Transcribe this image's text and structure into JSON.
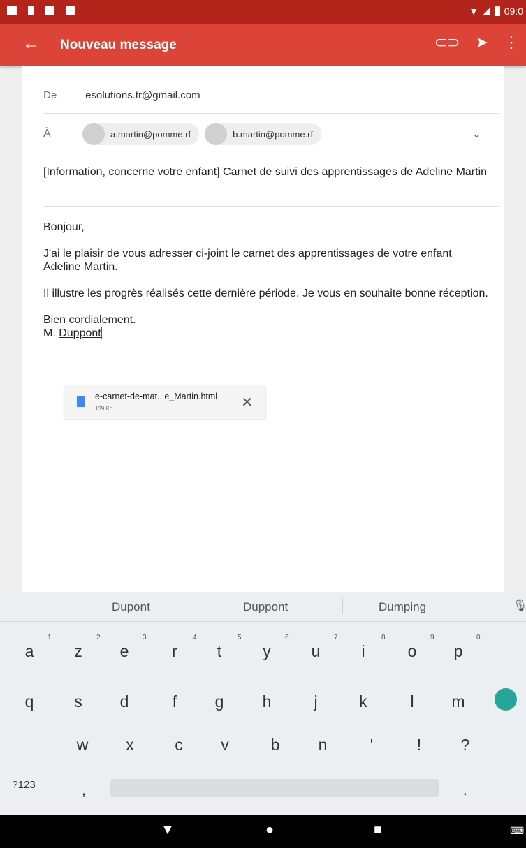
{
  "status_bar": {
    "time": "09:0"
  },
  "app_bar": {
    "title": "Nouveau message"
  },
  "compose": {
    "from_label": "De",
    "from_value": "esolutions.tr@gmail.com",
    "to_label": "À",
    "recipients": [
      "a.martin@pomme.rf",
      "b.martin@pomme.rf"
    ],
    "subject": "[Information, concerne votre enfant] Carnet de suivi des apprentissages de Adeline Martin",
    "body": {
      "greeting": "Bonjour,",
      "p1": "J'ai le plaisir de vous adresser ci-joint le carnet des apprentissages de votre enfant Adeline Martin.",
      "p2": "Il illustre les progrès réalisés cette dernière période. Je vous en souhaite bonne réception.",
      "closing": "Bien cordialement.",
      "signature_prefix": "M. ",
      "signature_name": "Duppont"
    },
    "attachment": {
      "name": "e-carnet-de-mat...e_Martin.html",
      "size": "139 Ko"
    }
  },
  "keyboard": {
    "suggestions": [
      "Dupont",
      "Duppont",
      "Dumping"
    ],
    "row1": [
      "a",
      "z",
      "e",
      "r",
      "t",
      "y",
      "u",
      "i",
      "o",
      "p"
    ],
    "row1_hints": [
      "1",
      "2",
      "3",
      "4",
      "5",
      "6",
      "7",
      "8",
      "9",
      "0"
    ],
    "row2": [
      "q",
      "s",
      "d",
      "f",
      "g",
      "h",
      "j",
      "k",
      "l",
      "m"
    ],
    "row3": [
      "w",
      "x",
      "c",
      "v",
      "b",
      "n",
      "'",
      "!",
      "?"
    ],
    "symbols_key": "?123",
    "comma_key": ",",
    "period_key": "."
  },
  "icons": [
    "back-arrow-icon",
    "attach-icon",
    "send-icon",
    "more-vert-icon",
    "chevron-down-icon",
    "file-icon",
    "close-icon",
    "mic-icon",
    "backspace-icon",
    "enter-icon",
    "shift-icon",
    "emoji-icon",
    "nav-back-icon",
    "nav-home-icon",
    "nav-recents-icon",
    "keyboard-icon"
  ],
  "colors": {
    "app_bar": "#db4437",
    "status_bar": "#b3251b",
    "enter_key": "#26a69a"
  }
}
